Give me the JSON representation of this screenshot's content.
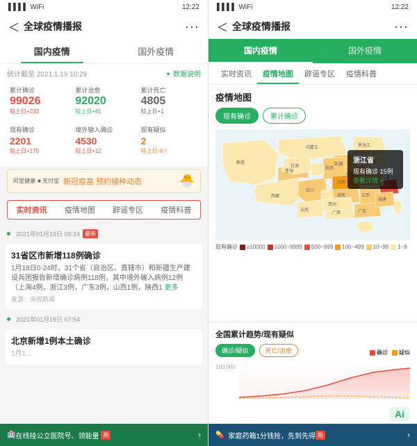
{
  "left": {
    "statusBar": {
      "signal": "四格信号",
      "wifi": "WiFi",
      "battery": "🔋",
      "time": "12:22"
    },
    "header": {
      "back": "＜",
      "title": "全球疫情播报",
      "more": "···"
    },
    "tabs": [
      {
        "label": "国内疫情",
        "active": true
      },
      {
        "label": "国外疫情",
        "active": false
      }
    ],
    "statsHeader": {
      "left": "统计截至 2021.1.19 10:29",
      "right": "✦ 数据说明"
    },
    "statsTop": [
      {
        "label": "累计确诊",
        "value": "99026",
        "change": "较上日+232"
      },
      {
        "label": "累计治愈",
        "value": "92020",
        "change": "较上日+61",
        "colorClass": "green"
      },
      {
        "label": "累计死亡",
        "value": "4805",
        "change": "较上日+1",
        "colorClass": "gray"
      }
    ],
    "statsBottom": [
      {
        "label": "现有确诊",
        "value": "2201",
        "change": "较上日+170",
        "color": "#e74c3c"
      },
      {
        "label": "境外输入确诊",
        "value": "4530",
        "change": "较上日+12",
        "color": "#e74c3c"
      },
      {
        "label": "现有疑似",
        "value": "2",
        "change": "较上日-9①",
        "color": "#e67e22"
      }
    ],
    "vaccineBanner": {
      "logos": [
        "阿里健康",
        "■ 支付宝"
      ],
      "text": "新冠疫苗 预约接种动态"
    },
    "subTabs": [
      {
        "label": "实时资讯",
        "active": true
      },
      {
        "label": "疫情地图",
        "active": false
      },
      {
        "label": "辟谣专区",
        "active": false
      },
      {
        "label": "疫情科普",
        "active": false
      }
    ],
    "news": [
      {
        "datetime": "2021年01月19日 08:24",
        "badge": "最新",
        "title": "31省区市新增118例确诊",
        "content": "1月18日0-24时，31个省（自治区、直辖市）和新疆生产建设兵团报告新增确诊病例118例，其中境外输入病例12例（上海4例，浙江3例，广东3例，山西1例，陕西1",
        "more": "更多",
        "source": "来源：央视新闻"
      },
      {
        "datetime": "2021年01月19日 07:54",
        "badge": "",
        "title": "北京新增1例本土确诊",
        "content": "1月1...",
        "more": "",
        "source": ""
      }
    ],
    "bottomBanner": {
      "text": "在线挂公立医院号、领能量",
      "hot": "热"
    }
  },
  "right": {
    "statusBar": {
      "signal": "四格信号",
      "wifi": "WiFi",
      "battery": "🔋",
      "time": "12:22"
    },
    "header": {
      "back": "＜",
      "title": "全球疫情播报",
      "more": "···"
    },
    "tabs": [
      {
        "label": "国内疫情",
        "active": true
      },
      {
        "label": "国外疫情",
        "active": false
      }
    ],
    "subTabs": [
      {
        "label": "实时资讯",
        "active": false
      },
      {
        "label": "疫情地图",
        "active": true
      },
      {
        "label": "辟谣专区",
        "active": false
      },
      {
        "label": "疫情科普",
        "active": false
      }
    ],
    "mapSection": {
      "title": "疫情地图",
      "mapTabs": [
        {
          "label": "现有确诊",
          "active": true
        },
        {
          "label": "累计确诊",
          "active": false
        }
      ],
      "tooltip": {
        "province": "浙江省",
        "count": "现有确诊 15例",
        "linkText": "查看详情 >"
      },
      "legendLabel": "现有确诊",
      "legendItems": [
        {
          "label": "≥10000",
          "color": "#8b1c1c"
        },
        {
          "label": "1000~9999",
          "color": "#c0392b"
        },
        {
          "label": "500~999",
          "color": "#e74c3c"
        },
        {
          "label": "100~499",
          "color": "#f39c12"
        },
        {
          "label": "10~99",
          "color": "#f9ca74"
        },
        {
          "label": "1~9",
          "color": "#fde8b0"
        }
      ]
    },
    "trendSection": {
      "title": "全国累计趋势/现有疑似",
      "tabs": [
        {
          "label": "确诊/疑似",
          "active": true,
          "color": "green"
        },
        {
          "label": "死亡/治愈",
          "active": false,
          "color": "orange"
        }
      ],
      "legendItems": [
        {
          "label": "确诊",
          "color": "#e74c3c"
        },
        {
          "label": "疑似",
          "color": "#f39c12"
        }
      ],
      "chartValue": "100,000"
    },
    "bottomBanner": {
      "text": "家庭药箱1分钱抢，先到先得",
      "hot": "热"
    },
    "aiText": "Ai"
  }
}
